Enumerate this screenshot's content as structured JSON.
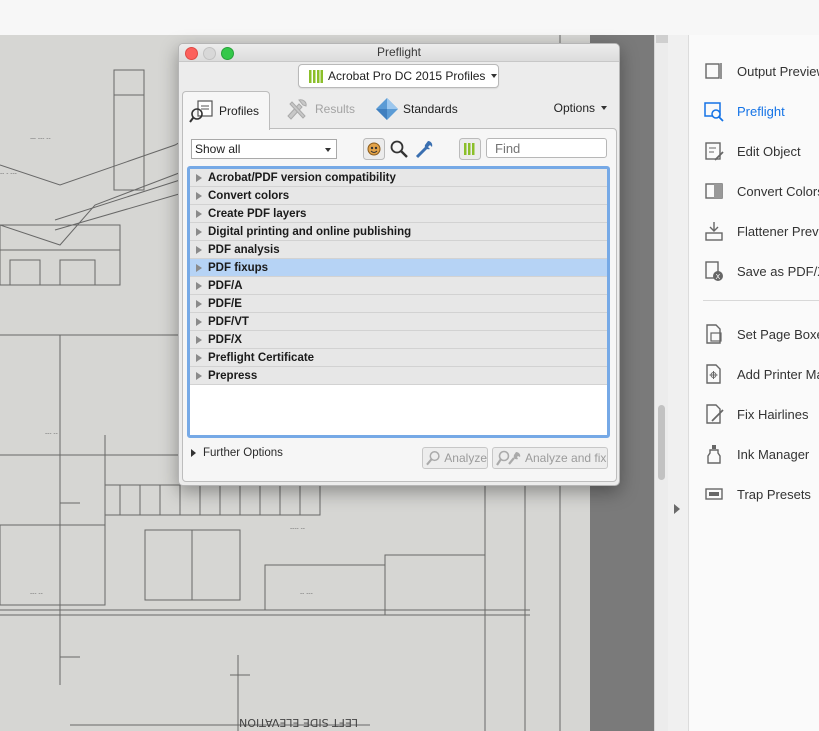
{
  "dialog": {
    "title": "Preflight",
    "profiles_selector": "Acrobat Pro DC 2015 Profiles",
    "tabs": [
      {
        "label": "Profiles"
      },
      {
        "label": "Results"
      },
      {
        "label": "Standards"
      }
    ],
    "options_label": "Options",
    "filter_value": "Show all",
    "find_placeholder": "Find",
    "categories": [
      "Acrobat/PDF version compatibility",
      "Convert colors",
      "Create PDF layers",
      "Digital printing and online publishing",
      "PDF analysis",
      "PDF fixups",
      "PDF/A",
      "PDF/E",
      "PDF/VT",
      "PDF/X",
      "Preflight Certificate",
      "Prepress"
    ],
    "highlighted_category": "PDF fixups",
    "further_options": "Further Options",
    "analyze_label": "Analyze",
    "analyze_fix_label": "Analyze and fix"
  },
  "tools_pane": {
    "items": [
      {
        "label": "Output Preview",
        "icon": "output-preview-icon"
      },
      {
        "label": "Preflight",
        "icon": "preflight-icon",
        "active": true
      },
      {
        "label": "Edit Object",
        "icon": "edit-object-icon"
      },
      {
        "label": "Convert Colors",
        "icon": "convert-colors-icon"
      },
      {
        "label": "Flattener Preview",
        "icon": "flattener-preview-icon"
      },
      {
        "label": "Save as PDF/X",
        "icon": "save-as-pdfx-icon"
      },
      {
        "label": "Set Page Boxes",
        "icon": "set-page-boxes-icon"
      },
      {
        "label": "Add Printer Marks",
        "icon": "add-printer-marks-icon"
      },
      {
        "label": "Fix Hairlines",
        "icon": "fix-hairlines-icon"
      },
      {
        "label": "Ink Manager",
        "icon": "ink-manager-icon"
      },
      {
        "label": "Trap Presets",
        "icon": "trap-presets-icon"
      }
    ]
  },
  "document": {
    "drawing_title": "LEFT SIDE ELEVATION"
  },
  "colors": {
    "accent": "#1473e6",
    "list_focus": "#76a9e6",
    "highlight_row": "#b6d3f5"
  }
}
